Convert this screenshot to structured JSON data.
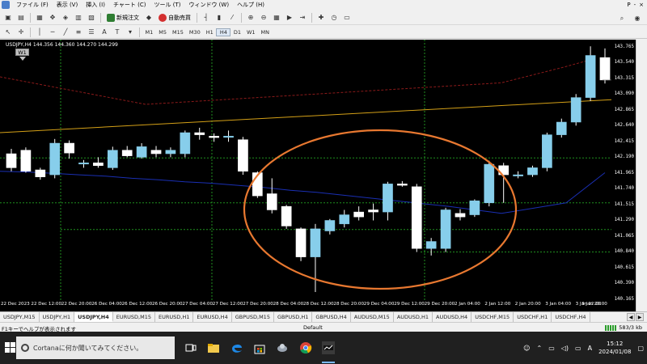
{
  "menu": {
    "items": [
      "ファイル (F)",
      "表示 (V)",
      "挿入 (I)",
      "チャート (C)",
      "ツール (T)",
      "ウィンドウ (W)",
      "ヘルプ (H)"
    ],
    "right_controls": [
      "P",
      "-",
      "×"
    ]
  },
  "toolbar": {
    "new_order_label": "新規注文",
    "auto_trade_label": "自動売買",
    "timeframes": [
      "M1",
      "M5",
      "M15",
      "M30",
      "H1",
      "H4",
      "D1",
      "W1",
      "MN"
    ],
    "active_timeframe": "H4",
    "icons": [
      "new-chart-icon",
      "profiles-icon",
      "market-watch-icon",
      "navigator-icon",
      "data-window-icon",
      "terminal-icon",
      "tester-icon",
      "cursor-icon",
      "crosshair-icon",
      "vertical-line-icon",
      "horizontal-line-icon",
      "trendline-icon",
      "channel-icon",
      "fibonacci-icon",
      "text-icon",
      "label-icon",
      "bar-chart-icon",
      "candles-icon",
      "line-chart-icon",
      "zoom-in-icon",
      "zoom-out-icon",
      "tile-icon",
      "autoscroll-icon",
      "chart-shift-icon",
      "indicators-icon",
      "periods-icon",
      "templates-icon",
      "search-icon",
      "community-icon"
    ]
  },
  "chart": {
    "symbol_info": "USDJPY,H4  144.356 144.360 144.270 144.299",
    "timeframe_badge": "W1",
    "colors": {
      "background": "#000000",
      "bull": "#87ceeb",
      "bear": "#ffffff",
      "ma_fast": "#1a2fb3",
      "ma_slow": "#8b1a1a",
      "trendline": "#d4a017",
      "level": "#1f8f1f",
      "annotation": "#e87830"
    },
    "price_labels": [
      "143.765",
      "143.540",
      "143.315",
      "143.090",
      "142.865",
      "142.640",
      "142.415",
      "142.190",
      "141.965",
      "141.740",
      "141.515",
      "141.290",
      "141.065",
      "140.840",
      "140.615",
      "140.390",
      "140.165"
    ],
    "time_labels": [
      "22 Dec 2023",
      "22 Dec 12:00",
      "22 Dec 20:00",
      "26 Dec 04:00",
      "26 Dec 12:00",
      "26 Dec 20:00",
      "27 Dec 04:00",
      "27 Dec 12:00",
      "27 Dec 20:00",
      "28 Dec 04:00",
      "28 Dec 12:00",
      "28 Dec 20:00",
      "29 Dec 04:00",
      "29 Dec 12:00",
      "29 Dec 20:00",
      "2 Jan 04:00",
      "2 Jan 12:00",
      "2 Jan 20:00",
      "3 Jan 04:00",
      "3 Jan 12:00",
      "3 Jan 20:00"
    ]
  },
  "chart_data": {
    "type": "candlestick",
    "symbol": "USDJPY",
    "timeframe": "H4",
    "ylim": [
      140.165,
      143.875
    ],
    "candles": [
      {
        "o": 142.25,
        "h": 142.32,
        "l": 142.0,
        "c": 142.05
      },
      {
        "o": 142.3,
        "h": 142.34,
        "l": 141.98,
        "c": 142.0
      },
      {
        "o": 142.02,
        "h": 142.05,
        "l": 141.88,
        "c": 141.92
      },
      {
        "o": 141.95,
        "h": 142.46,
        "l": 141.9,
        "c": 142.4
      },
      {
        "o": 142.4,
        "h": 142.44,
        "l": 142.18,
        "c": 142.26
      },
      {
        "o": 142.12,
        "h": 142.16,
        "l": 142.05,
        "c": 142.12
      },
      {
        "o": 142.12,
        "h": 142.2,
        "l": 142.05,
        "c": 142.08
      },
      {
        "o": 142.05,
        "h": 142.35,
        "l": 142.02,
        "c": 142.3
      },
      {
        "o": 142.3,
        "h": 142.36,
        "l": 142.2,
        "c": 142.22
      },
      {
        "o": 142.2,
        "h": 142.4,
        "l": 142.18,
        "c": 142.35
      },
      {
        "o": 142.3,
        "h": 142.36,
        "l": 142.2,
        "c": 142.25
      },
      {
        "o": 142.25,
        "h": 142.34,
        "l": 142.2,
        "c": 142.3
      },
      {
        "o": 142.25,
        "h": 142.58,
        "l": 142.2,
        "c": 142.55
      },
      {
        "o": 142.55,
        "h": 142.62,
        "l": 142.45,
        "c": 142.52
      },
      {
        "o": 142.5,
        "h": 142.54,
        "l": 142.42,
        "c": 142.48
      },
      {
        "o": 142.5,
        "h": 142.58,
        "l": 142.42,
        "c": 142.5
      },
      {
        "o": 142.45,
        "h": 142.49,
        "l": 141.95,
        "c": 142.0
      },
      {
        "o": 141.98,
        "h": 142.0,
        "l": 141.62,
        "c": 141.65
      },
      {
        "o": 141.68,
        "h": 141.9,
        "l": 141.4,
        "c": 141.45
      },
      {
        "o": 141.5,
        "h": 141.52,
        "l": 141.18,
        "c": 141.22
      },
      {
        "o": 141.18,
        "h": 141.2,
        "l": 140.72,
        "c": 140.78
      },
      {
        "o": 140.78,
        "h": 141.25,
        "l": 140.28,
        "c": 141.18
      },
      {
        "o": 141.15,
        "h": 141.32,
        "l": 141.1,
        "c": 141.3
      },
      {
        "o": 141.25,
        "h": 141.45,
        "l": 141.2,
        "c": 141.38
      },
      {
        "o": 141.42,
        "h": 141.5,
        "l": 141.3,
        "c": 141.35
      },
      {
        "o": 141.45,
        "h": 141.54,
        "l": 141.3,
        "c": 141.42
      },
      {
        "o": 141.42,
        "h": 141.85,
        "l": 141.3,
        "c": 141.82
      },
      {
        "o": 141.82,
        "h": 141.86,
        "l": 141.78,
        "c": 141.8
      },
      {
        "o": 141.78,
        "h": 141.82,
        "l": 140.85,
        "c": 140.9
      },
      {
        "o": 140.9,
        "h": 141.05,
        "l": 140.8,
        "c": 141.0
      },
      {
        "o": 140.9,
        "h": 141.48,
        "l": 140.85,
        "c": 141.45
      },
      {
        "o": 141.4,
        "h": 141.46,
        "l": 141.3,
        "c": 141.35
      },
      {
        "o": 141.38,
        "h": 141.6,
        "l": 141.35,
        "c": 141.58
      },
      {
        "o": 141.55,
        "h": 142.15,
        "l": 141.5,
        "c": 142.1
      },
      {
        "o": 142.08,
        "h": 142.12,
        "l": 141.55,
        "c": 141.95
      },
      {
        "o": 141.95,
        "h": 142.0,
        "l": 141.9,
        "c": 141.95
      },
      {
        "o": 141.95,
        "h": 142.08,
        "l": 141.92,
        "c": 142.05
      },
      {
        "o": 142.05,
        "h": 142.55,
        "l": 142.0,
        "c": 142.52
      },
      {
        "o": 142.52,
        "h": 142.75,
        "l": 142.48,
        "c": 142.7
      },
      {
        "o": 142.7,
        "h": 143.1,
        "l": 142.65,
        "c": 143.05
      },
      {
        "o": 143.05,
        "h": 143.78,
        "l": 143.0,
        "c": 143.65
      },
      {
        "o": 143.62,
        "h": 143.75,
        "l": 143.25,
        "c": 143.3
      }
    ],
    "ma_fast": [
      142.0,
      141.99,
      141.97,
      141.95,
      141.93,
      141.9,
      141.88,
      141.85,
      141.83,
      141.8,
      141.77,
      141.73,
      141.7,
      141.66,
      141.62,
      141.58,
      141.54,
      141.5,
      141.45,
      141.4
    ],
    "ma_slow": [
      143.26,
      143.37,
      143.48,
      143.6
    ],
    "trendline": {
      "from": 142.55,
      "to": 143.02
    },
    "levels": [
      142.19,
      141.55,
      141.17,
      140.85
    ],
    "annotation": "ellipse-highlight"
  },
  "tabs": {
    "items": [
      "USDJPY,M15",
      "USDJPY,H1",
      "USDJPY,H4",
      "EURUSD,M15",
      "EURUSD,H1",
      "EURUSD,H4",
      "GBPUSD,M15",
      "GBPUSD,H1",
      "GBPUSD,H4",
      "AUDUSD,M15",
      "AUDUSD,H1",
      "AUDUSD,H4",
      "USDCHF,M15",
      "USDCHF,H1",
      "USDCHF,H4"
    ],
    "active": "USDJPY,H4"
  },
  "status": {
    "help": "F1キーでヘルプが表示されます",
    "profile": "Default",
    "connection": "583/3 kb"
  },
  "taskbar": {
    "search_placeholder": "Cortanaに何か聞いてみてください。",
    "time": "15:12",
    "date": "2024/01/08",
    "ime": "A"
  }
}
